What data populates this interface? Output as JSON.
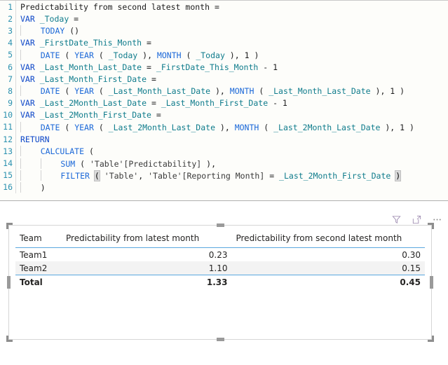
{
  "editor": {
    "name": "dax-formula-editor",
    "language": "DAX",
    "line_count": 16,
    "lines": [
      {
        "n": "1",
        "indent": 0,
        "text": "Predictability from second latest month ="
      },
      {
        "n": "2",
        "indent": 0,
        "text": "VAR _Today ="
      },
      {
        "n": "3",
        "indent": 1,
        "text": "TODAY ()"
      },
      {
        "n": "4",
        "indent": 0,
        "text": "VAR _FirstDate_This_Month ="
      },
      {
        "n": "5",
        "indent": 1,
        "text": "DATE ( YEAR ( _Today ), MONTH ( _Today ), 1 )"
      },
      {
        "n": "6",
        "indent": 0,
        "text": "VAR _Last_Month_Last_Date = _FirstDate_This_Month - 1"
      },
      {
        "n": "7",
        "indent": 0,
        "text": "VAR _Last_Month_First_Date ="
      },
      {
        "n": "8",
        "indent": 1,
        "text": "DATE ( YEAR ( _Last_Month_Last_Date ), MONTH ( _Last_Month_Last_Date ), 1 )"
      },
      {
        "n": "9",
        "indent": 0,
        "text": "VAR _Last_2Month_Last_Date = _Last_Month_First_Date - 1"
      },
      {
        "n": "10",
        "indent": 0,
        "text": "VAR _Last_2Month_First_Date ="
      },
      {
        "n": "11",
        "indent": 1,
        "text": "DATE ( YEAR ( _Last_2Month_Last_Date ), MONTH ( _Last_2Month_Last_Date ), 1 )"
      },
      {
        "n": "12",
        "indent": 0,
        "text": "RETURN"
      },
      {
        "n": "13",
        "indent": 1,
        "text": "CALCULATE ("
      },
      {
        "n": "14",
        "indent": 2,
        "text": "SUM ( 'Table'[Predictability] ),"
      },
      {
        "n": "15",
        "indent": 2,
        "text": "FILTER ( 'Table', 'Table'[Reporting Month] = _Last_2Month_First_Date )"
      },
      {
        "n": "16",
        "indent": 1,
        "text": ")"
      }
    ],
    "tokens": {
      "line1": [
        {
          "t": "Predictability from second latest month =",
          "c": "plain"
        }
      ],
      "line2": [
        {
          "t": "VAR ",
          "c": "kw"
        },
        {
          "t": "_Today",
          "c": "varn"
        },
        {
          "t": " =",
          "c": "plain"
        }
      ],
      "line3": [
        {
          "t": "TODAY",
          "c": "fn"
        },
        {
          "t": " ()",
          "c": "plain"
        }
      ],
      "line4": [
        {
          "t": "VAR ",
          "c": "kw"
        },
        {
          "t": "_FirstDate_This_Month",
          "c": "varn"
        },
        {
          "t": " =",
          "c": "plain"
        }
      ],
      "line5": [
        {
          "t": "DATE",
          "c": "fn"
        },
        {
          "t": " ( ",
          "c": "plain"
        },
        {
          "t": "YEAR",
          "c": "fn"
        },
        {
          "t": " ( ",
          "c": "plain"
        },
        {
          "t": "_Today",
          "c": "varn"
        },
        {
          "t": " ), ",
          "c": "plain"
        },
        {
          "t": "MONTH",
          "c": "fn"
        },
        {
          "t": " ( ",
          "c": "plain"
        },
        {
          "t": "_Today",
          "c": "varn"
        },
        {
          "t": " ), ",
          "c": "plain"
        },
        {
          "t": "1",
          "c": "num"
        },
        {
          "t": " )",
          "c": "plain"
        }
      ],
      "line6": [
        {
          "t": "VAR ",
          "c": "kw"
        },
        {
          "t": "_Last_Month_Last_Date",
          "c": "varn"
        },
        {
          "t": " = ",
          "c": "plain"
        },
        {
          "t": "_FirstDate_This_Month",
          "c": "varn"
        },
        {
          "t": " - ",
          "c": "plain"
        },
        {
          "t": "1",
          "c": "num"
        }
      ],
      "line7": [
        {
          "t": "VAR ",
          "c": "kw"
        },
        {
          "t": "_Last_Month_First_Date",
          "c": "varn"
        },
        {
          "t": " =",
          "c": "plain"
        }
      ],
      "line8": [
        {
          "t": "DATE",
          "c": "fn"
        },
        {
          "t": " ( ",
          "c": "plain"
        },
        {
          "t": "YEAR",
          "c": "fn"
        },
        {
          "t": " ( ",
          "c": "plain"
        },
        {
          "t": "_Last_Month_Last_Date",
          "c": "varn"
        },
        {
          "t": " ), ",
          "c": "plain"
        },
        {
          "t": "MONTH",
          "c": "fn"
        },
        {
          "t": " ( ",
          "c": "plain"
        },
        {
          "t": "_Last_Month_Last_Date",
          "c": "varn"
        },
        {
          "t": " ), ",
          "c": "plain"
        },
        {
          "t": "1",
          "c": "num"
        },
        {
          "t": " )",
          "c": "plain"
        }
      ],
      "line9": [
        {
          "t": "VAR ",
          "c": "kw"
        },
        {
          "t": "_Last_2Month_Last_Date",
          "c": "varn"
        },
        {
          "t": " = ",
          "c": "plain"
        },
        {
          "t": "_Last_Month_First_Date",
          "c": "varn"
        },
        {
          "t": " - ",
          "c": "plain"
        },
        {
          "t": "1",
          "c": "num"
        }
      ],
      "line10": [
        {
          "t": "VAR ",
          "c": "kw"
        },
        {
          "t": "_Last_2Month_First_Date",
          "c": "varn"
        },
        {
          "t": " =",
          "c": "plain"
        }
      ],
      "line11": [
        {
          "t": "DATE",
          "c": "fn"
        },
        {
          "t": " ( ",
          "c": "plain"
        },
        {
          "t": "YEAR",
          "c": "fn"
        },
        {
          "t": " ( ",
          "c": "plain"
        },
        {
          "t": "_Last_2Month_Last_Date",
          "c": "varn"
        },
        {
          "t": " ), ",
          "c": "plain"
        },
        {
          "t": "MONTH",
          "c": "fn"
        },
        {
          "t": " ( ",
          "c": "plain"
        },
        {
          "t": "_Last_2Month_Last_Date",
          "c": "varn"
        },
        {
          "t": " ), ",
          "c": "plain"
        },
        {
          "t": "1",
          "c": "num"
        },
        {
          "t": " )",
          "c": "plain"
        }
      ],
      "line12": [
        {
          "t": "RETURN",
          "c": "kw"
        }
      ],
      "line13": [
        {
          "t": "CALCULATE",
          "c": "fn"
        },
        {
          "t": " (",
          "c": "plain"
        }
      ],
      "line14": [
        {
          "t": "SUM",
          "c": "fn"
        },
        {
          "t": " ( ",
          "c": "plain"
        },
        {
          "t": "'Table'[Predictability]",
          "c": "str"
        },
        {
          "t": " ),",
          "c": "plain"
        }
      ],
      "line15": [
        {
          "t": "FILTER",
          "c": "fn"
        },
        {
          "t": " ",
          "c": "plain"
        },
        {
          "t": "(",
          "c": "paren-hl"
        },
        {
          "t": " ",
          "c": "plain"
        },
        {
          "t": "'Table'",
          "c": "str"
        },
        {
          "t": ", ",
          "c": "plain"
        },
        {
          "t": "'Table'[Reporting Month]",
          "c": "str"
        },
        {
          "t": " = ",
          "c": "plain"
        },
        {
          "t": "_Last_2Month_First_Date",
          "c": "varn"
        },
        {
          "t": " ",
          "c": "plain"
        },
        {
          "t": ")",
          "c": "paren-hl"
        }
      ],
      "line16": [
        {
          "t": ")",
          "c": "plain"
        }
      ]
    },
    "colors": {
      "keyword": "#0d47c8",
      "function": "#1b68d8",
      "variable": "#0f7c8c",
      "line_number": "#2b91af",
      "background": "#fdfdfa",
      "paren_match_highlight": "#dadada"
    },
    "caret_after_line": "15"
  },
  "visual_header": {
    "icons": [
      {
        "name": "filter-icon",
        "glyph": "filter",
        "tooltip": "Filters"
      },
      {
        "name": "focus-mode-icon",
        "glyph": "expand",
        "tooltip": "Focus mode"
      },
      {
        "name": "more-options-icon",
        "glyph": "ellipsis",
        "tooltip": "More options"
      }
    ],
    "icon_color": "#a392b5"
  },
  "table_visual": {
    "name": "table-visual",
    "selected": true,
    "accent_color": "#5aa7e0",
    "alt_row_color": "#f3f3f3",
    "columns": [
      {
        "key": "team",
        "label": "Team",
        "align": "left"
      },
      {
        "key": "m1",
        "label": "Predictability from latest month",
        "align": "right"
      },
      {
        "key": "m2",
        "label": "Predictability from second latest month",
        "align": "right"
      }
    ],
    "rows": [
      {
        "team": "Team1",
        "m1": "0.23",
        "m2": "0.30",
        "alt": false
      },
      {
        "team": "Team2",
        "m1": "1.10",
        "m2": "0.15",
        "alt": true
      }
    ],
    "total": {
      "team": "Total",
      "m1": "1.33",
      "m2": "0.45"
    }
  },
  "chart_data": {
    "type": "table",
    "title": "",
    "categories": [
      "Team1",
      "Team2",
      "Total"
    ],
    "series": [
      {
        "name": "Predictability from latest month",
        "values": [
          0.23,
          1.1,
          1.33
        ]
      },
      {
        "name": "Predictability from second latest month",
        "values": [
          0.3,
          0.15,
          0.45
        ]
      }
    ],
    "xlabel": "Team",
    "ylabel": "",
    "legend": "none",
    "grid": false
  }
}
